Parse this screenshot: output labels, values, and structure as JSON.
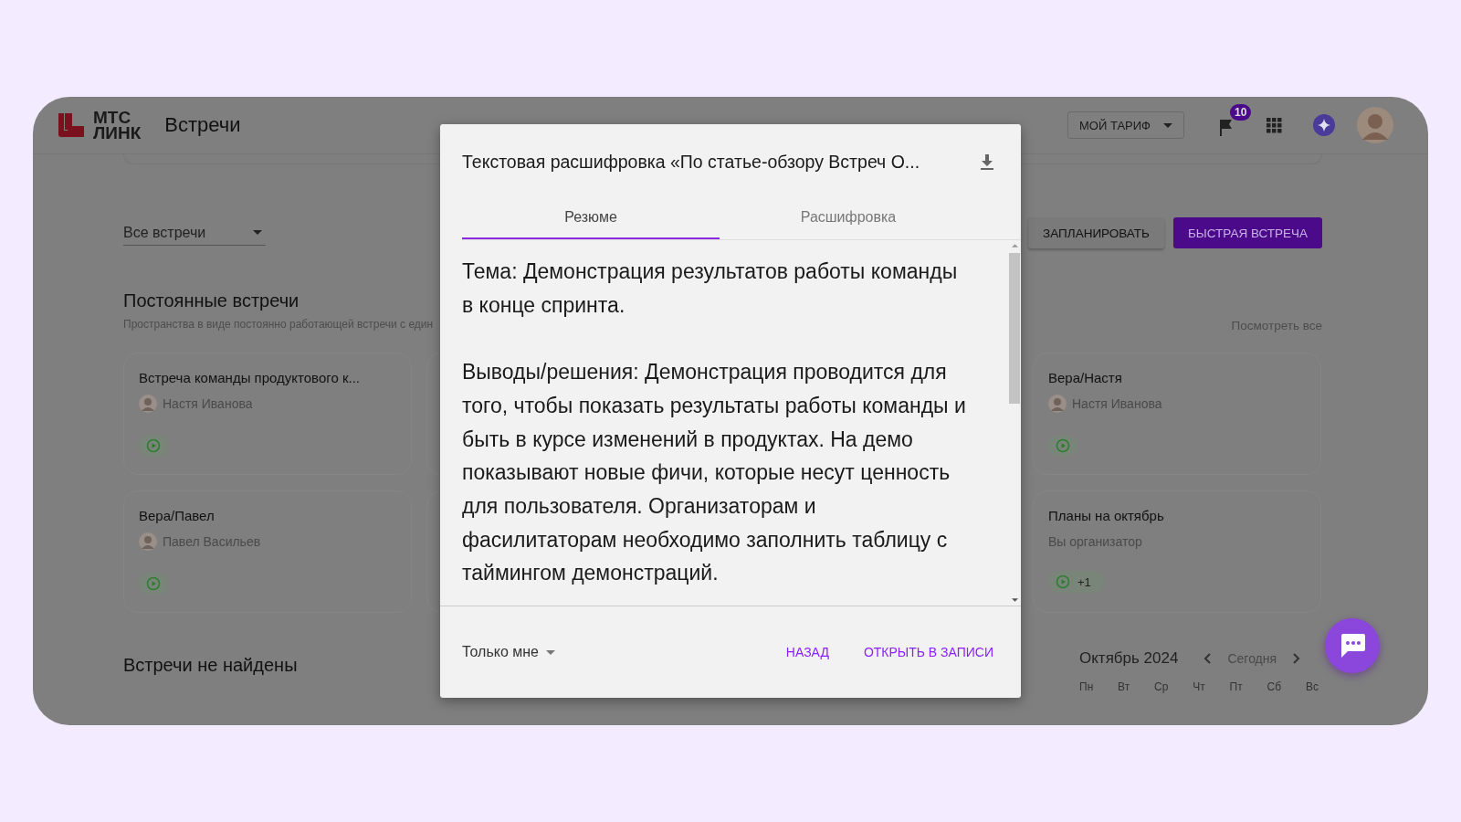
{
  "header": {
    "logo_lines": [
      "МТС",
      "ЛИНК"
    ],
    "title": "Встречи",
    "plan_select": "МОЙ ТАРИФ",
    "notifications_badge": "10"
  },
  "filter": {
    "value": "Все встречи"
  },
  "buttons": [
    {
      "label": "ЗАПЛАНИРОВАТЬ",
      "kind": "secondary"
    },
    {
      "label": "БЫСТРАЯ ВСТРЕЧА",
      "kind": "primary"
    }
  ],
  "section": {
    "title": "Постоянные встречи",
    "subtitle": "Пространства в виде постоянно работающей встречи с един",
    "see_all": "Посмотреть все"
  },
  "card_columns": [
    [
      {
        "title": "Встреча команды продуктового к...",
        "kind": "owner",
        "person": "Настя Иванова"
      },
      {
        "title": "Вера/Павел",
        "kind": "owner",
        "person": "Павел Васильев"
      }
    ],
    [
      {
        "title": "Вера/Настя",
        "kind": "owner",
        "person": "Настя Иванова"
      },
      {
        "title": "Планы на октябрь",
        "kind": "organizer",
        "note": "Вы организатор",
        "extra": "+1"
      }
    ]
  ],
  "empty_title": "Встречи не найдены",
  "calendar": {
    "month": "Октябрь 2024",
    "today": "Сегодня",
    "weekdays": [
      "Пн",
      "Вт",
      "Ср",
      "Чт",
      "Пт",
      "Сб",
      "Вс"
    ]
  },
  "modal": {
    "title": "Текстовая расшифровка «По статье-обзору Встреч О...",
    "tabs": [
      {
        "label": "Резюме",
        "selected": true
      },
      {
        "label": "Расшифровка",
        "selected": false
      }
    ],
    "paragraphs": [
      "Тема: Демонстрация результатов работы команды в конце спринта.",
      "Выводы/решения: Демонстрация проводится для того, чтобы показать результаты работы команды и быть в курсе изменений в продуктах. На демо показывают новые фичи, которые несут ценность для пользователя. Организаторам и фасилитаторам необходимо заполнить таблицу с таймингом демонстраций."
    ],
    "audience": "Только мне",
    "actions": [
      "НАЗАД",
      "ОТКРЫТЬ В ЗАПИСИ"
    ]
  }
}
